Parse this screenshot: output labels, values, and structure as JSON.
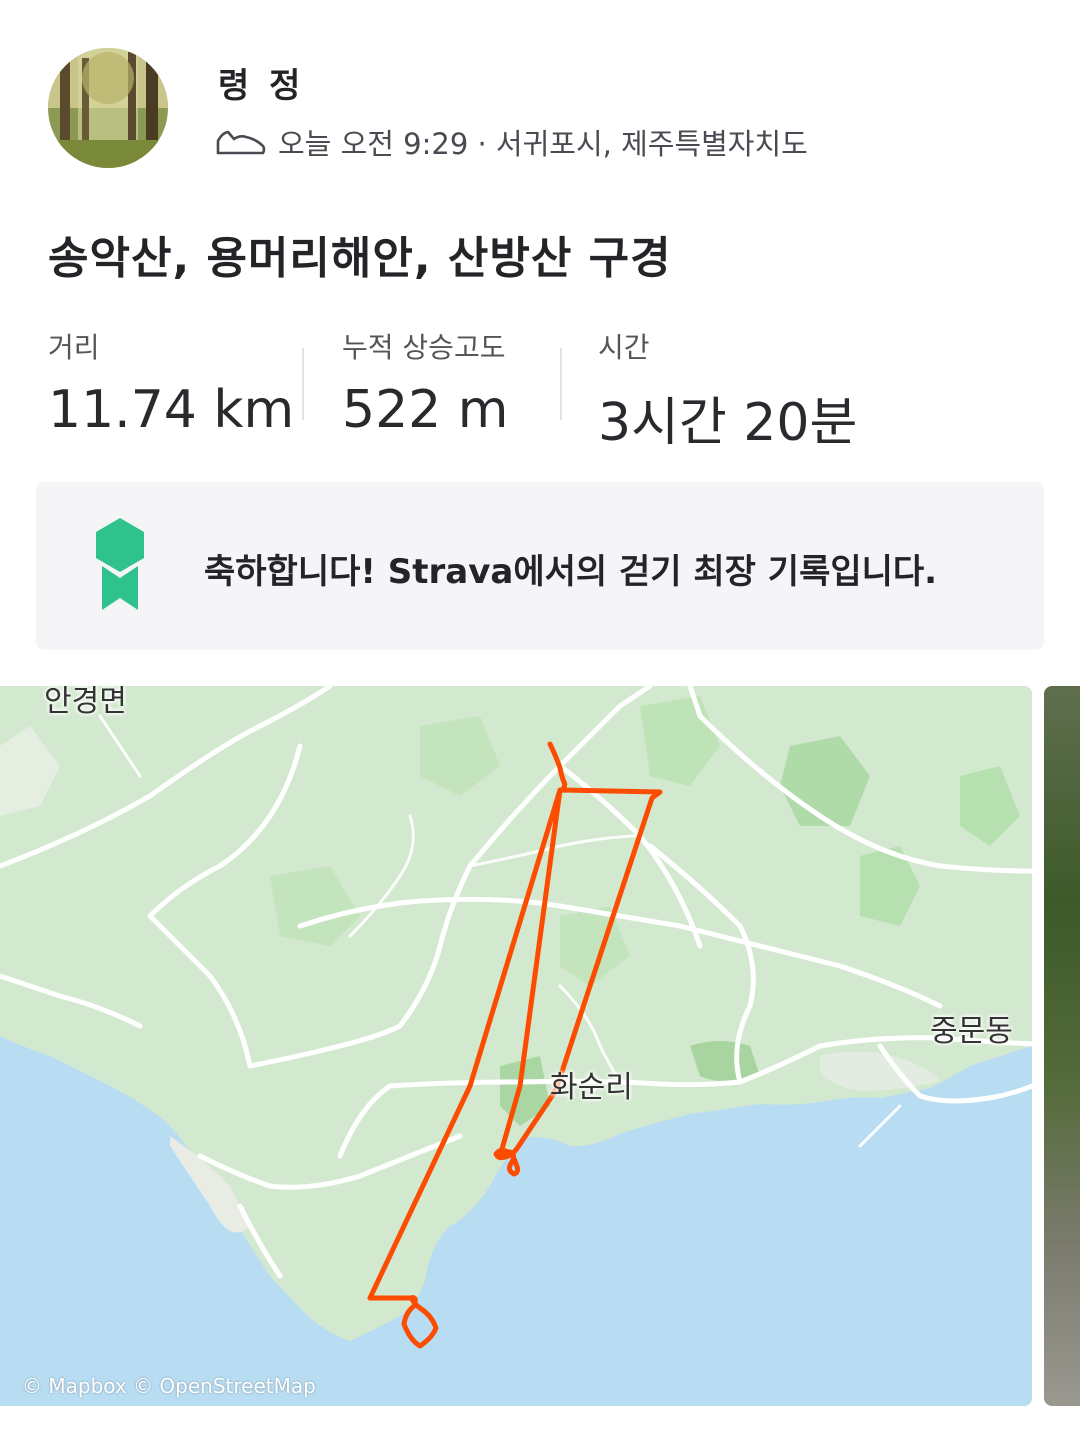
{
  "header": {
    "athlete_name": "령 정",
    "activity_icon": "shoe-icon",
    "meta": "오늘 오전 9:29 · 서귀포시, 제주특별자치도"
  },
  "activity": {
    "title": "송악산, 용머리해안, 산방산 구경"
  },
  "stats": [
    {
      "label": "거리",
      "value": "11.74 km"
    },
    {
      "label": "누적 상승고도",
      "value": "522 m"
    },
    {
      "label": "시간",
      "value": "3시간 20분"
    }
  ],
  "achievement": {
    "icon": "medal-icon",
    "prefix": "축하합니다! ",
    "brand": "Strava",
    "suffix": "에서의 걷기 최장 기록입니다.",
    "accent_color": "#2fc28c"
  },
  "map": {
    "labels": [
      "안경면",
      "중문동",
      "화순리"
    ],
    "attribution": "© Mapbox © OpenStreetMap",
    "route_color": "#fc4c02",
    "land_color": "#cfe7cd",
    "water_color": "#b8dcf2"
  }
}
